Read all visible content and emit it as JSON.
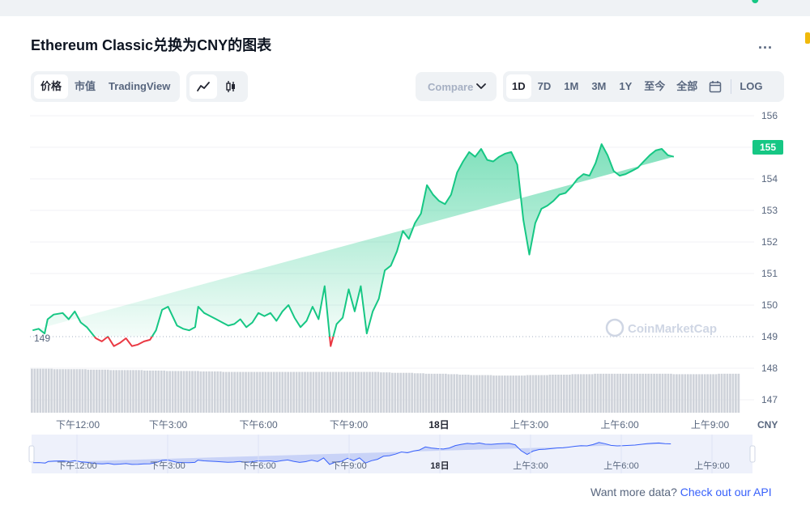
{
  "title": "Ethereum Classic兑换为CNY的图表",
  "more_label": "...",
  "view_tabs": [
    {
      "label": "价格",
      "active": true
    },
    {
      "label": "市值",
      "active": false
    },
    {
      "label": "TradingView",
      "active": false
    }
  ],
  "chart_style_buttons": [
    {
      "icon": "line-chart-icon",
      "active": true
    },
    {
      "icon": "candlestick-icon",
      "active": false
    }
  ],
  "compare_label": "Compare",
  "time_range": [
    {
      "label": "1D",
      "active": true
    },
    {
      "label": "7D",
      "active": false
    },
    {
      "label": "1M",
      "active": false
    },
    {
      "label": "3M",
      "active": false
    },
    {
      "label": "1Y",
      "active": false
    },
    {
      "label": "至今",
      "active": false
    },
    {
      "label": "全部",
      "active": false
    }
  ],
  "calendar_icon": "calendar-icon",
  "log_label": "LOG",
  "watermark": "CoinMarketCap",
  "api_text": "Want more data?",
  "api_link": "Check out our API",
  "colors": {
    "up": "#16c784",
    "down": "#ea3943",
    "volume": "#cfd3da",
    "accent": "#3861fb"
  },
  "chart_data": {
    "type": "line",
    "currency": "CNY",
    "y_ticks": [
      156,
      155,
      154,
      153,
      152,
      151,
      150,
      149,
      148,
      147
    ],
    "ylim": [
      146.7,
      156.3
    ],
    "baseline": 149,
    "baseline_label": "149",
    "current_price": 155,
    "current_label": "155",
    "x_labels": [
      "下午12:00",
      "下午3:00",
      "下午6:00",
      "下午9:00",
      "18日",
      "上午3:00",
      "上午6:00",
      "上午9:00"
    ],
    "x_label_bold": [
      false,
      false,
      false,
      false,
      true,
      false,
      false,
      false
    ],
    "hours": [
      -1.5,
      -1.3,
      -1.1,
      -1.0,
      -0.8,
      -0.5,
      -0.3,
      -0.1,
      0.1,
      0.3,
      0.6,
      0.8,
      1.0,
      1.2,
      1.4,
      1.6,
      1.8,
      2.0,
      2.2,
      2.4,
      2.6,
      2.8,
      3.0,
      3.1,
      3.3,
      3.5,
      3.7,
      3.9,
      4.0,
      4.2,
      4.4,
      4.6,
      4.8,
      5.0,
      5.2,
      5.4,
      5.6,
      5.8,
      6.0,
      6.2,
      6.4,
      6.6,
      6.8,
      7.0,
      7.2,
      7.4,
      7.6,
      7.8,
      8.0,
      8.2,
      8.4,
      8.6,
      8.8,
      9.0,
      9.2,
      9.4,
      9.6,
      9.8,
      10.0,
      10.2,
      10.4,
      10.6,
      10.8,
      11.0,
      11.2,
      11.4,
      11.6,
      11.8,
      12.0,
      12.2,
      12.4,
      12.6,
      12.8,
      13.0,
      13.2,
      13.4,
      13.6,
      13.8,
      14.0,
      14.2,
      14.4,
      14.6,
      14.8,
      15.0,
      15.2,
      15.4,
      15.6,
      15.8,
      16.0,
      16.2,
      16.4,
      16.6,
      16.8,
      17.0,
      17.2,
      17.4,
      17.6,
      17.8,
      18.0,
      18.2,
      18.4,
      18.6,
      18.8,
      19.0,
      19.2,
      19.4,
      19.6,
      19.8,
      20.0,
      20.2,
      20.4,
      20.6,
      20.8,
      21.0,
      21.2,
      21.4,
      21.6,
      21.8,
      22.0,
      22.2,
      22.4,
      22.5
    ],
    "prices": [
      149.2,
      149.25,
      149.1,
      149.55,
      149.7,
      149.75,
      149.55,
      149.8,
      149.45,
      149.3,
      148.95,
      148.85,
      149.0,
      148.7,
      148.8,
      148.95,
      148.7,
      148.75,
      148.85,
      148.9,
      149.2,
      149.85,
      149.95,
      149.75,
      149.35,
      149.25,
      149.2,
      149.3,
      149.95,
      149.75,
      149.65,
      149.55,
      149.45,
      149.35,
      149.4,
      149.55,
      149.3,
      149.45,
      149.75,
      149.65,
      149.75,
      149.5,
      149.8,
      150.0,
      149.6,
      149.3,
      149.5,
      149.95,
      149.55,
      150.6,
      148.7,
      149.4,
      149.6,
      150.5,
      149.8,
      150.6,
      149.1,
      149.8,
      150.2,
      151.1,
      151.25,
      151.7,
      152.35,
      152.1,
      152.6,
      152.9,
      153.8,
      153.5,
      153.3,
      153.2,
      153.5,
      154.2,
      154.55,
      154.85,
      154.7,
      154.95,
      154.6,
      154.55,
      154.7,
      154.8,
      154.85,
      154.45,
      152.7,
      151.6,
      152.6,
      153.05,
      153.15,
      153.3,
      153.5,
      153.55,
      153.75,
      154.0,
      154.15,
      154.1,
      154.5,
      155.1,
      154.75,
      154.25,
      154.1,
      154.15,
      154.25,
      154.35,
      154.55,
      154.75,
      154.9,
      154.95,
      154.75,
      154.7
    ],
    "volume_levels": [
      0.97,
      0.97,
      0.96,
      0.96,
      0.96,
      0.95,
      0.95,
      0.94,
      0.94,
      0.94,
      0.93,
      0.93,
      0.92,
      0.92,
      0.92,
      0.91,
      0.91,
      0.9,
      0.9,
      0.9,
      0.9,
      0.9,
      0.9,
      0.9,
      0.9,
      0.9,
      0.9,
      0.9,
      0.9,
      0.9,
      0.9,
      0.89,
      0.88,
      0.88,
      0.87,
      0.86,
      0.86,
      0.85,
      0.84,
      0.83,
      0.83,
      0.82,
      0.82,
      0.82,
      0.83,
      0.83,
      0.84,
      0.84,
      0.85,
      0.85,
      0.86,
      0.86,
      0.86,
      0.86,
      0.86,
      0.86,
      0.86,
      0.85,
      0.85,
      0.85,
      0.85,
      0.86,
      0.86
    ]
  }
}
